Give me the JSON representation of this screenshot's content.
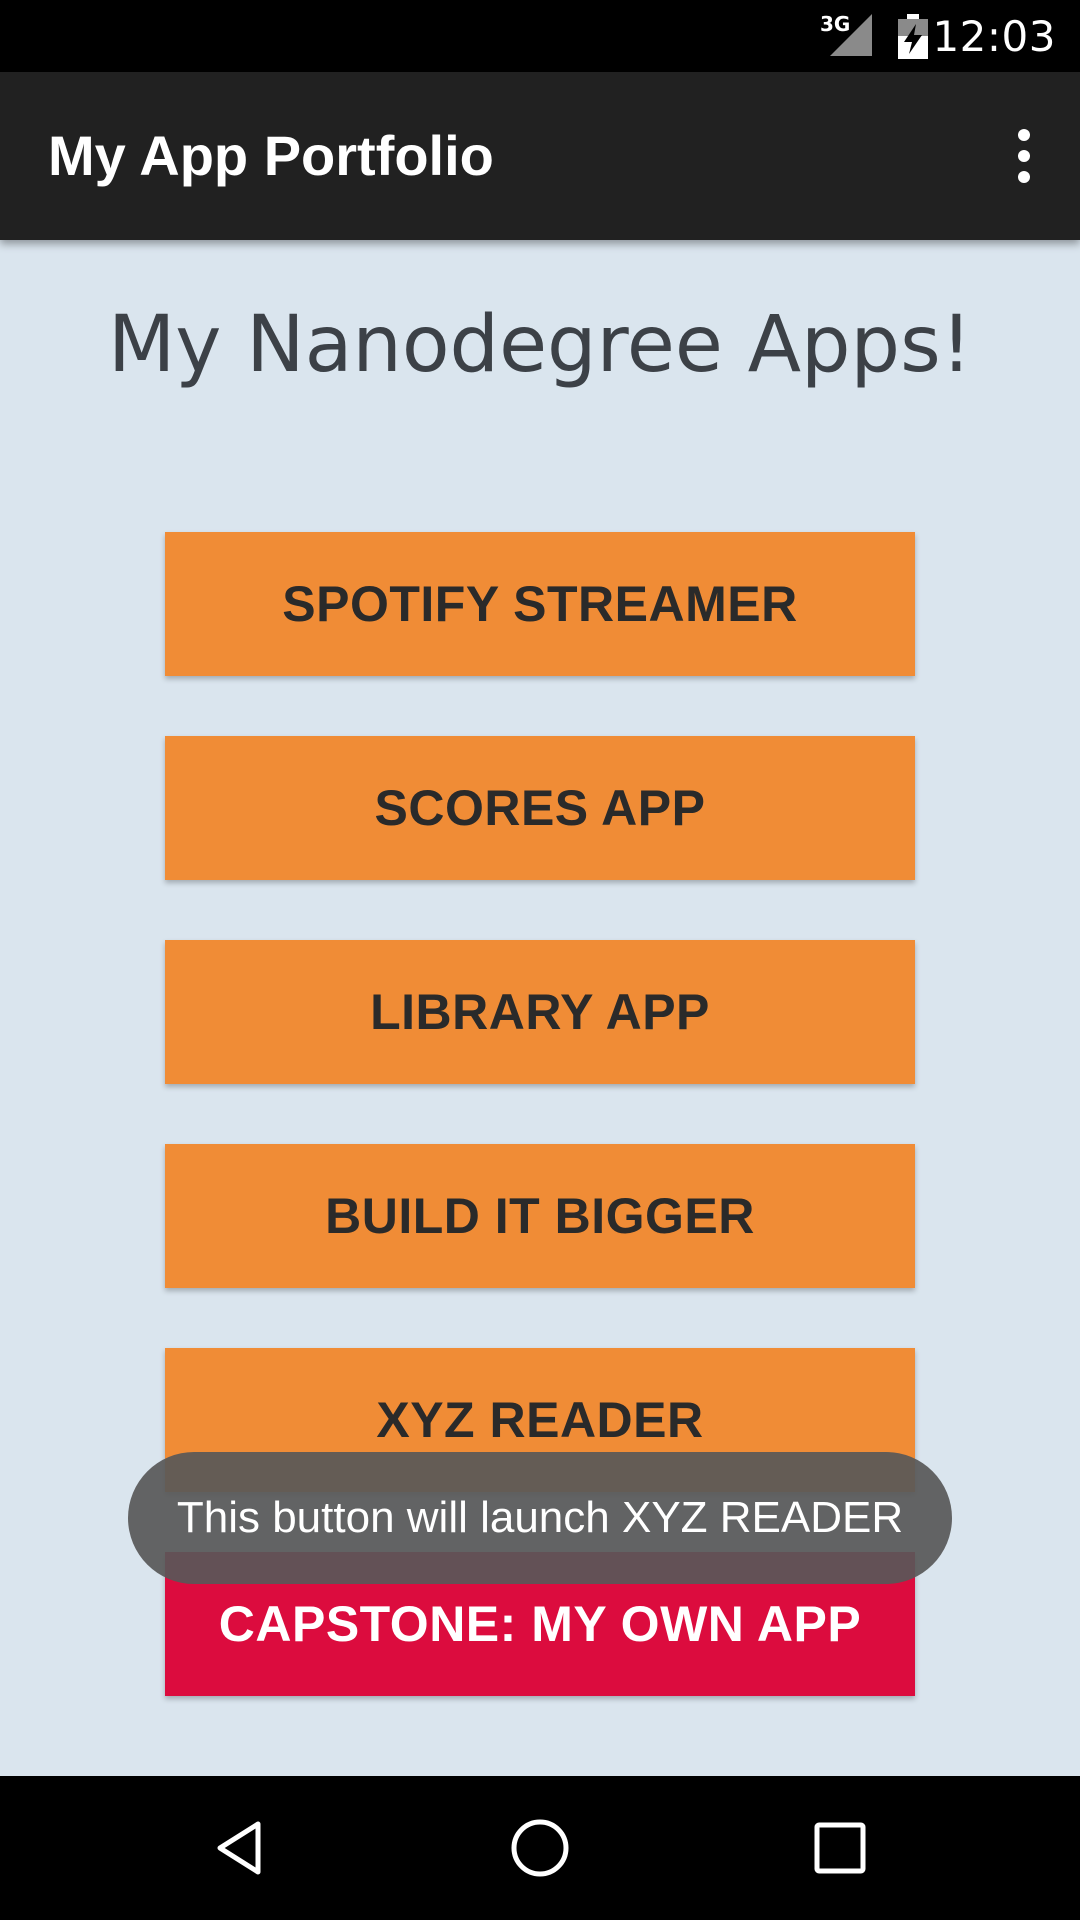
{
  "status_bar": {
    "network": "3G",
    "time": "12:03",
    "signal_icon": "cell-signal-icon",
    "battery_icon": "battery-charging-icon"
  },
  "app_bar": {
    "title": "My App Portfolio",
    "menu_icon": "overflow-menu-icon"
  },
  "main": {
    "heading": "My Nanodegree Apps!",
    "buttons": [
      {
        "label": "SPOTIFY STREAMER"
      },
      {
        "label": "SCORES APP"
      },
      {
        "label": "LIBRARY APP"
      },
      {
        "label": "BUILD IT BIGGER"
      },
      {
        "label": "XYZ READER"
      },
      {
        "label": "CAPSTONE: MY OWN APP"
      }
    ]
  },
  "toast": {
    "message": "This button will launch XYZ READER"
  },
  "nav_bar": {
    "back_icon": "back-icon",
    "home_icon": "home-icon",
    "recents_icon": "recents-icon"
  },
  "colors": {
    "background": "#dae5ee",
    "app_bar": "#212121",
    "button_orange": "#f08c36",
    "button_red": "#dc0c3e",
    "toast": "#585858"
  }
}
